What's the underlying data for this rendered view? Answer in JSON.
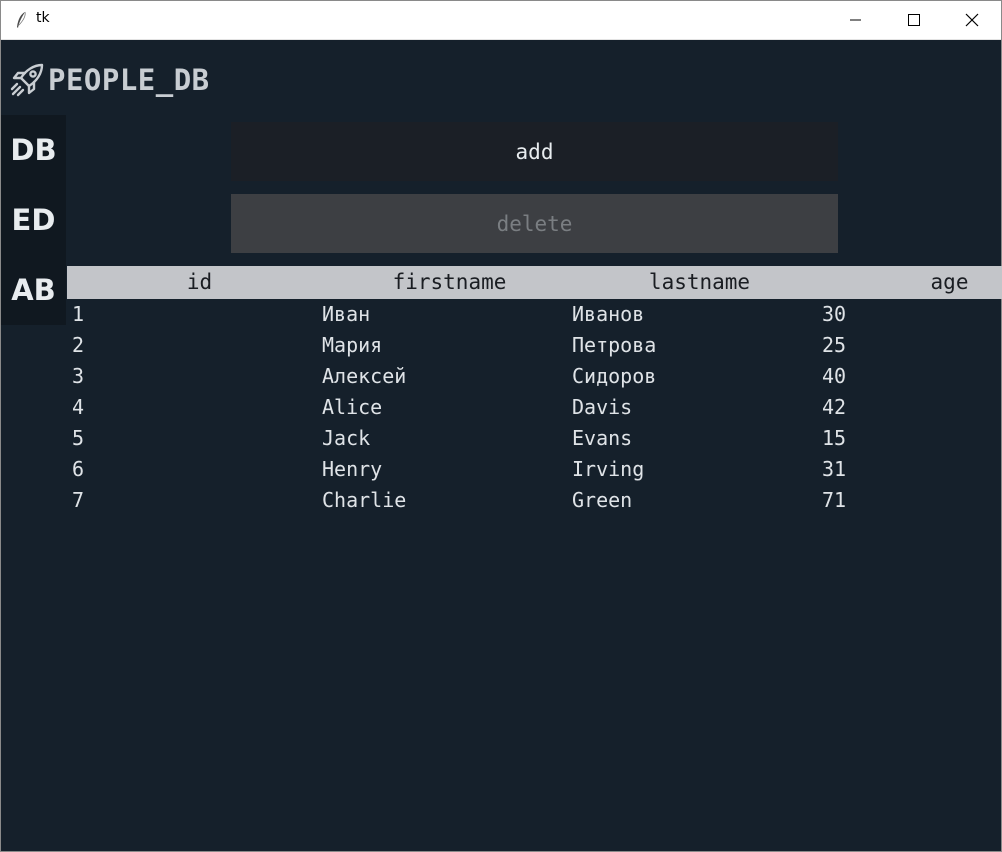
{
  "window": {
    "title": "tk",
    "controls": [
      "minimize-icon",
      "maximize-icon",
      "close-icon"
    ]
  },
  "header": {
    "icon": "rocket-icon",
    "title": "PEOPLE_DB"
  },
  "sidebar": {
    "items": [
      {
        "label": "DB"
      },
      {
        "label": "ED"
      },
      {
        "label": "AB"
      }
    ]
  },
  "actions": {
    "add_label": "add",
    "delete_label": "delete"
  },
  "table": {
    "columns": [
      "id",
      "firstname",
      "lastname",
      "age"
    ],
    "rows": [
      [
        "1",
        "Иван",
        "Иванов",
        "30"
      ],
      [
        "2",
        "Мария",
        "Петрова",
        "25"
      ],
      [
        "3",
        "Алексей",
        "Сидоров",
        "40"
      ],
      [
        "4",
        "Alice",
        "Davis",
        "42"
      ],
      [
        "5",
        "Jack",
        "Evans",
        "15"
      ],
      [
        "6",
        "Henry",
        "Irving",
        "31"
      ],
      [
        "7",
        "Charlie",
        "Green",
        "71"
      ]
    ]
  },
  "colors": {
    "background": "#15202b",
    "sidebar": "#101820",
    "add_button": "#1b1f26",
    "delete_button": "#3d3f43",
    "table_header": "#c3c5c9",
    "text": "#dfe3e7"
  }
}
